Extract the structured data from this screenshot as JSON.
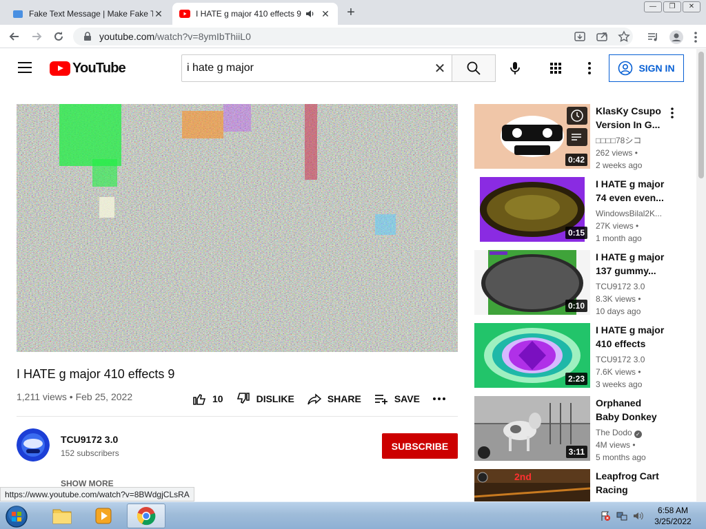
{
  "browser": {
    "tabs": [
      {
        "title": "Fake Text Message | Make Fake Te",
        "active": false
      },
      {
        "title": "I HATE g major 410 effects 9",
        "active": true
      }
    ],
    "url_host": "youtube.com",
    "url_path": "/watch?v=8ymIbThiiL0",
    "status_url": "https://www.youtube.com/watch?v=8BWdgjCLsRA"
  },
  "youtube": {
    "logo_text": "YouTube",
    "search_value": "i hate g major",
    "signin_label": "SIGN IN"
  },
  "video": {
    "title": "I HATE g major 410 effects 9",
    "views": "1,211 views",
    "date": "Feb 25, 2022",
    "likes": "10",
    "dislike_label": "DISLIKE",
    "share_label": "SHARE",
    "save_label": "SAVE"
  },
  "channel": {
    "name": "TCU9172 3.0",
    "subscribers": "152 subscribers",
    "subscribe_label": "SUBSCRIBE",
    "show_more": "SHOW MORE"
  },
  "recommendations": [
    {
      "title": "KlasKy Csupo Version In G...",
      "channel": "□□□□78シコ",
      "views": "262 views •",
      "age": "2 weeks ago",
      "duration": "0:42"
    },
    {
      "title": "I HATE g major 74 even even...",
      "channel": "WindowsBilal2K...",
      "views": "27K views •",
      "age": "1 month ago",
      "duration": "0:15"
    },
    {
      "title": "I HATE g major 137 gummy...",
      "channel": "TCU9172 3.0",
      "views": "8.3K views •",
      "age": "10 days ago",
      "duration": "0:10"
    },
    {
      "title": "I HATE g major 410 effects",
      "channel": "TCU9172 3.0",
      "views": "7.6K views •",
      "age": "3 weeks ago",
      "duration": "2:23"
    },
    {
      "title": "Orphaned Baby Donkey Cried...",
      "channel": "The Dodo",
      "views": "4M views •",
      "age": "5 months ago",
      "duration": "3:11"
    },
    {
      "title": "Leapfrog Cart Racing Super...",
      "channel": "",
      "views": "",
      "age": "",
      "duration": ""
    }
  ],
  "taskbar": {
    "time": "6:58 AM",
    "date": "3/25/2022"
  },
  "colors": {
    "youtube_red": "#ff0000",
    "subscribe_red": "#cc0000",
    "link_blue": "#065fd4"
  }
}
